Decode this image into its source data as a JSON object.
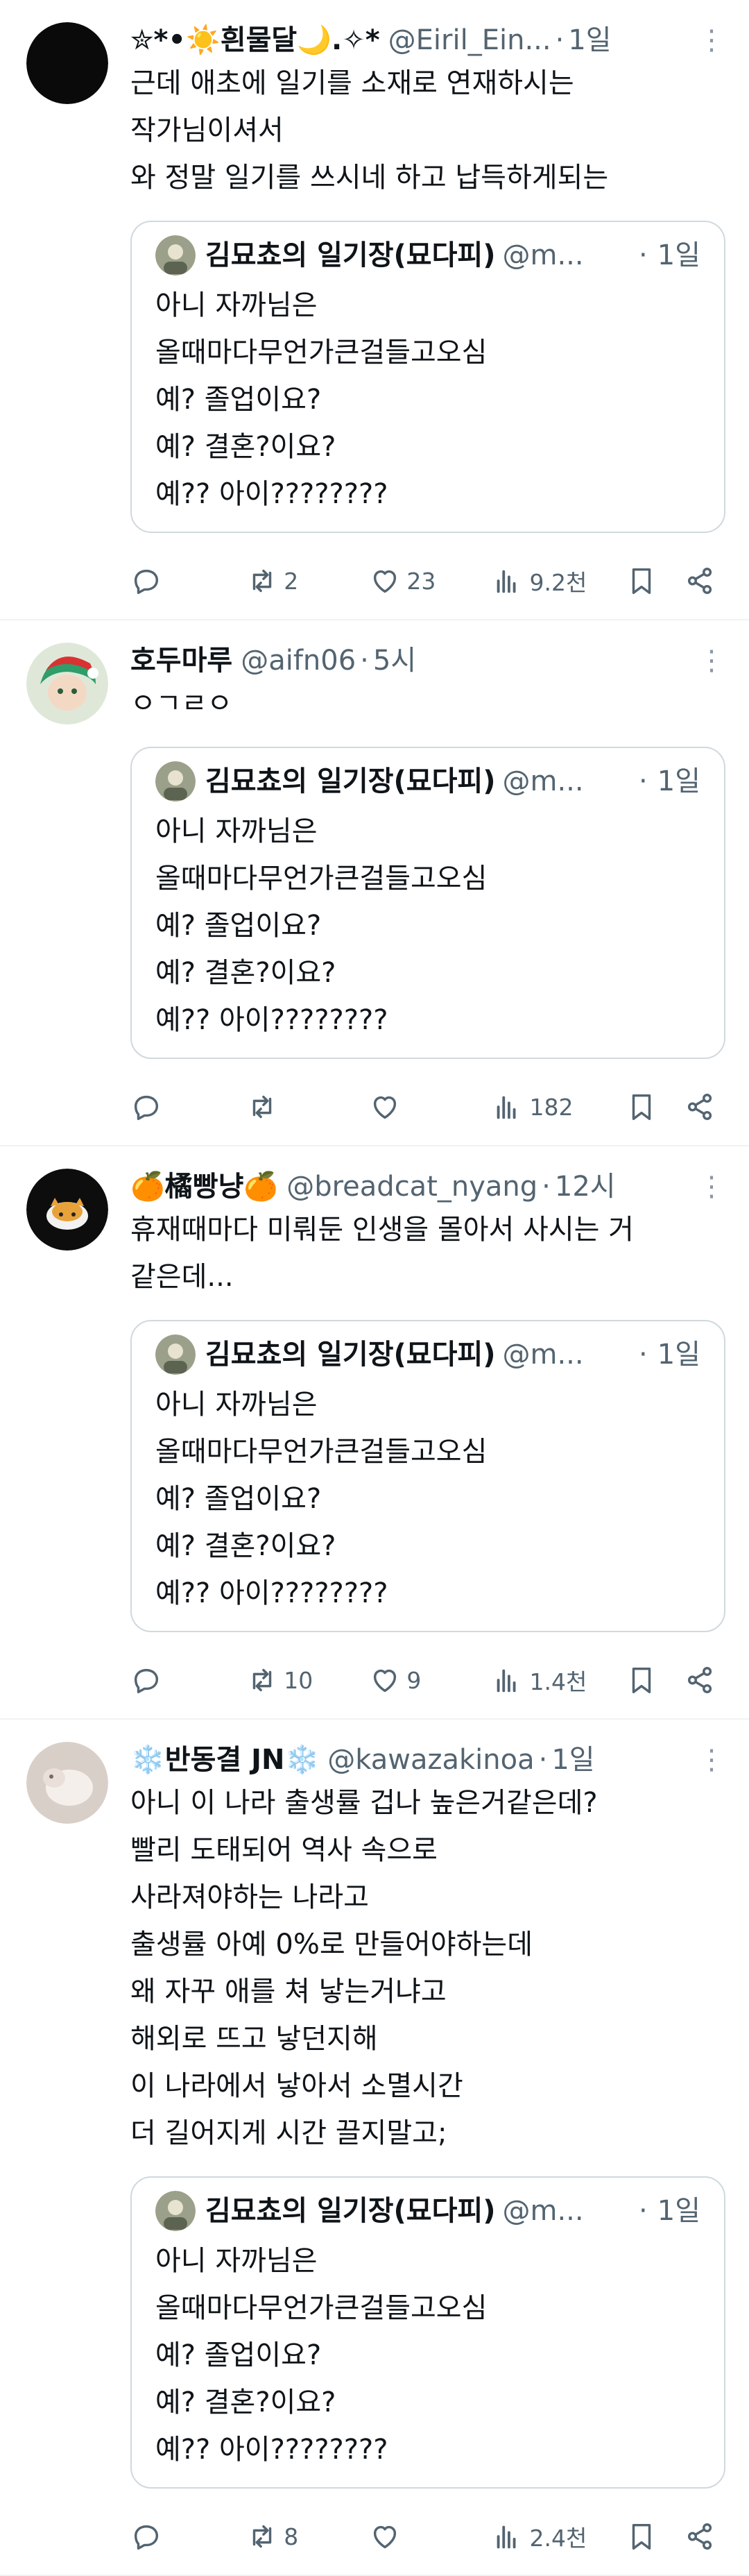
{
  "tweets": [
    {
      "display_name": "✮*•☀️흰물달🌙.✧*",
      "handle": "@Eiril_Ein...",
      "time": "1일",
      "text": "근데 애초에 일기를 소재로 연재하시는\n작가님이셔서\n와 정말 일기를 쓰시네 하고 납득하게되는",
      "quote": {
        "display_name": "김묘쵸의 일기장(묘다피)",
        "handle": "@m...",
        "time": "1일",
        "text": "아니 자까님은\n올때마다무언가큰걸들고오심\n예? 졸업이요?\n예? 결혼?이요?\n예?? 아이????????"
      },
      "stats": {
        "replies": "",
        "retweets": "2",
        "likes": "23",
        "views": "9.2천"
      }
    },
    {
      "display_name": "호두마루",
      "handle": "@aifn06",
      "time": "5시",
      "text": "ㅇㄱㄹㅇ",
      "quote": {
        "display_name": "김묘쵸의 일기장(묘다피)",
        "handle": "@m...",
        "time": "1일",
        "text": "아니 자까님은\n올때마다무언가큰걸들고오심\n예? 졸업이요?\n예? 결혼?이요?\n예?? 아이????????"
      },
      "stats": {
        "replies": "",
        "retweets": "",
        "likes": "",
        "views": "182"
      }
    },
    {
      "display_name": "🍊橘빵냥🍊",
      "handle": "@breadcat_nyang",
      "time": "12시",
      "text": "휴재때마다 미뤄둔 인생을 몰아서 사시는 거\n같은데...",
      "quote": {
        "display_name": "김묘쵸의 일기장(묘다피)",
        "handle": "@m...",
        "time": "1일",
        "text": "아니 자까님은\n올때마다무언가큰걸들고오심\n예? 졸업이요?\n예? 결혼?이요?\n예?? 아이????????"
      },
      "stats": {
        "replies": "",
        "retweets": "10",
        "likes": "9",
        "views": "1.4천"
      }
    },
    {
      "display_name": "❄️반동결 JN❄️",
      "handle": "@kawazakinoa",
      "time": "1일",
      "text": "아니 이 나라 출생률 겁나 높은거같은데?\n빨리 도태되어 역사 속으로\n사라져야하는 나라고\n출생률 아예 0%로 만들어야하는데\n왜 자꾸 애를 쳐 낳는거냐고\n해외로 뜨고 낳던지해\n이 나라에서 낳아서 소멸시간\n더 길어지게 시간 끌지말고;",
      "quote": {
        "display_name": "김묘쵸의 일기장(묘다피)",
        "handle": "@m...",
        "time": "1일",
        "text": "아니 자까님은\n올때마다무언가큰걸들고오심\n예? 졸업이요?\n예? 결혼?이요?\n예?? 아이????????"
      },
      "stats": {
        "replies": "",
        "retweets": "8",
        "likes": "",
        "views": "2.4천"
      }
    }
  ],
  "separator": "·",
  "more_symbol": "⋮",
  "colors": {
    "muted": "#536471",
    "border": "#cfd9de",
    "divider": "#eff3f4",
    "text": "#0f1419"
  },
  "icons": [
    "reply-icon",
    "retweet-icon",
    "like-icon",
    "views-icon",
    "bookmark-icon",
    "share-icon"
  ]
}
